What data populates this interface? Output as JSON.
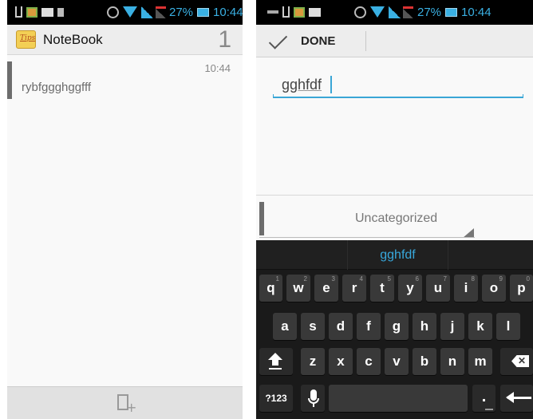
{
  "left_screen": {
    "status_bar": {
      "battery_percent": "27%",
      "time": "10:44"
    },
    "app_bar": {
      "title": "NoteBook",
      "count": "1",
      "icon_label": "Tips",
      "icon": "notebook-icon"
    },
    "notes": [
      {
        "time": "10:44",
        "preview": "rybfggghggfff"
      }
    ],
    "bottom_bar": {
      "new_note_icon": "new-note-icon"
    }
  },
  "right_screen": {
    "status_bar": {
      "battery_percent": "27%",
      "time": "10:44"
    },
    "action_bar": {
      "done_label": "DONE",
      "done_icon": "checkmark-icon"
    },
    "editor": {
      "text": "gghfdf"
    },
    "category": {
      "label": "Uncategorized"
    },
    "keyboard": {
      "suggestion": "gghfdf",
      "row1": [
        {
          "key": "q",
          "num": "1"
        },
        {
          "key": "w",
          "num": "2"
        },
        {
          "key": "e",
          "num": "3"
        },
        {
          "key": "r",
          "num": "4"
        },
        {
          "key": "t",
          "num": "5"
        },
        {
          "key": "y",
          "num": "6"
        },
        {
          "key": "u",
          "num": "7"
        },
        {
          "key": "i",
          "num": "8"
        },
        {
          "key": "o",
          "num": "9"
        },
        {
          "key": "p",
          "num": "0"
        }
      ],
      "row2": [
        "a",
        "s",
        "d",
        "f",
        "g",
        "h",
        "j",
        "k",
        "l"
      ],
      "row3": [
        "z",
        "x",
        "c",
        "v",
        "b",
        "n",
        "m"
      ],
      "symbols_label": "?123",
      "period_label": "."
    }
  },
  "colors": {
    "accent": "#38a8dc",
    "keyboard_bg": "#1a1a1a",
    "key_bg": "#393939",
    "stripe": "#6d6d6d"
  }
}
